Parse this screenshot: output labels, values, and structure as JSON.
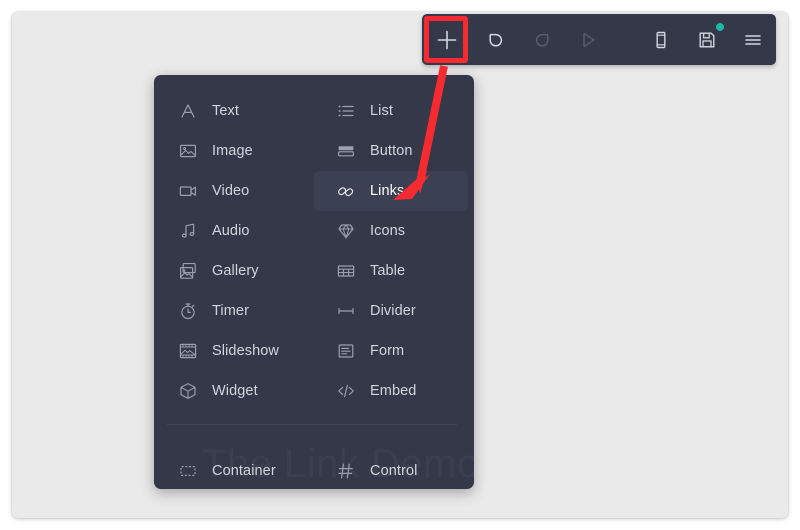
{
  "app": {
    "canvas_watermark": "The Link Demo",
    "accent_highlight_color": "#f62b32",
    "panel_color": "#343848",
    "canvas_color": "#eaeaea",
    "save_badge_color": "#1fb6a4"
  },
  "toolbar": {
    "items": [
      {
        "name": "add",
        "icon": "plus-icon",
        "label": "Add",
        "state": "highlighted"
      },
      {
        "name": "undo",
        "icon": "undo-icon",
        "label": "Undo",
        "state": "enabled"
      },
      {
        "name": "redo",
        "icon": "redo-icon",
        "label": "Redo",
        "state": "disabled"
      },
      {
        "name": "preview",
        "icon": "play-icon",
        "label": "Preview",
        "state": "disabled"
      },
      {
        "name": "device",
        "icon": "phone-icon",
        "label": "Device Preview",
        "state": "enabled"
      },
      {
        "name": "save",
        "icon": "save-icon",
        "label": "Save",
        "state": "enabled",
        "badge": true
      },
      {
        "name": "menu",
        "icon": "hamburger-icon",
        "label": "Menu",
        "state": "enabled"
      }
    ]
  },
  "add_menu": {
    "selected": "Links",
    "items": [
      {
        "label": "Text",
        "icon": "text-icon"
      },
      {
        "label": "List",
        "icon": "list-icon"
      },
      {
        "label": "Image",
        "icon": "image-icon"
      },
      {
        "label": "Button",
        "icon": "button-icon"
      },
      {
        "label": "Video",
        "icon": "video-icon"
      },
      {
        "label": "Links",
        "icon": "link-icon"
      },
      {
        "label": "Audio",
        "icon": "audio-icon"
      },
      {
        "label": "Icons",
        "icon": "diamond-icon"
      },
      {
        "label": "Gallery",
        "icon": "gallery-icon"
      },
      {
        "label": "Table",
        "icon": "table-icon"
      },
      {
        "label": "Timer",
        "icon": "timer-icon"
      },
      {
        "label": "Divider",
        "icon": "divider-icon"
      },
      {
        "label": "Slideshow",
        "icon": "slideshow-icon"
      },
      {
        "label": "Form",
        "icon": "form-icon"
      },
      {
        "label": "Widget",
        "icon": "widget-icon"
      },
      {
        "label": "Embed",
        "icon": "embed-icon"
      }
    ],
    "footer_items": [
      {
        "label": "Container",
        "icon": "container-icon"
      },
      {
        "label": "Control",
        "icon": "hash-icon"
      }
    ]
  }
}
